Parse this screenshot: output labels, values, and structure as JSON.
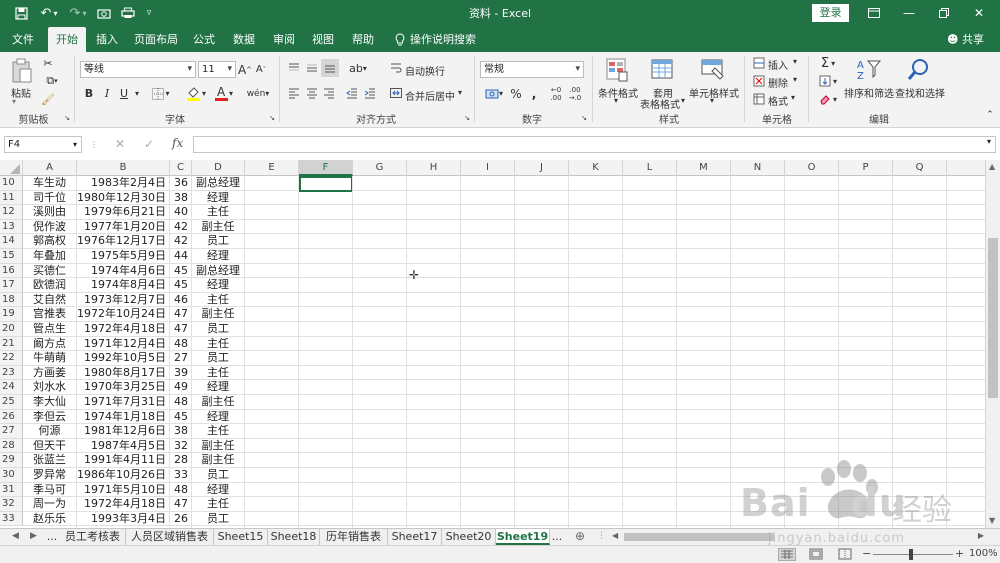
{
  "window": {
    "title": "资料 - Excel",
    "login": "登录",
    "share": "共享"
  },
  "tabs": [
    "文件",
    "开始",
    "插入",
    "页面布局",
    "公式",
    "数据",
    "审阅",
    "视图",
    "帮助"
  ],
  "active_tab": "开始",
  "tell_me": "操作说明搜索",
  "ribbon": {
    "clipboard": {
      "paste": "粘贴",
      "label": "剪贴板"
    },
    "font": {
      "name": "等线",
      "size": "11",
      "bold": "B",
      "italic": "I",
      "underline": "U",
      "grow": "A",
      "shrink": "A",
      "phonetic": "wén",
      "label": "字体"
    },
    "alignment": {
      "wrap": "自动换行",
      "merge": "合并后居中",
      "label": "对齐方式"
    },
    "number": {
      "format": "常规",
      "percent": "%",
      "comma": ",",
      "inc_dec": ".00",
      "label": "数字"
    },
    "styles": {
      "conditional": "条件格式",
      "table_line1": "套用",
      "table_line2": "表格格式",
      "cell_styles": "单元格样式",
      "label": "样式"
    },
    "cells": {
      "insert": "插入",
      "delete": "删除",
      "format": "格式",
      "label": "单元格"
    },
    "editing": {
      "sort": "排序和筛选",
      "find": "查找和选择",
      "label": "编辑"
    }
  },
  "formula_bar": {
    "name_box": "F4",
    "fx": "fx",
    "cancel": "✕",
    "enter": "✓"
  },
  "columns": [
    "A",
    "B",
    "C",
    "D",
    "E",
    "F",
    "G",
    "H",
    "I",
    "J",
    "K",
    "L",
    "M",
    "N",
    "O",
    "P",
    "Q"
  ],
  "selected_column": "F",
  "rows": [
    {
      "n": "10",
      "a": "车生动",
      "b": "1983年2月4日",
      "c": "36",
      "d": "副总经理"
    },
    {
      "n": "11",
      "a": "司千位",
      "b": "1980年12月30日",
      "c": "38",
      "d": "经理"
    },
    {
      "n": "12",
      "a": "溪则由",
      "b": "1979年6月21日",
      "c": "40",
      "d": "主任"
    },
    {
      "n": "13",
      "a": "倪作波",
      "b": "1977年1月20日",
      "c": "42",
      "d": "副主任"
    },
    {
      "n": "14",
      "a": "郭高权",
      "b": "1976年12月17日",
      "c": "42",
      "d": "员工"
    },
    {
      "n": "15",
      "a": "年叠加",
      "b": "1975年5月9日",
      "c": "44",
      "d": "经理"
    },
    {
      "n": "16",
      "a": "买德仁",
      "b": "1974年4月6日",
      "c": "45",
      "d": "副总经理"
    },
    {
      "n": "17",
      "a": "欧德润",
      "b": "1974年8月4日",
      "c": "45",
      "d": "经理"
    },
    {
      "n": "18",
      "a": "艾自然",
      "b": "1973年12月7日",
      "c": "46",
      "d": "主任"
    },
    {
      "n": "19",
      "a": "宫推表",
      "b": "1972年10月24日",
      "c": "47",
      "d": "副主任"
    },
    {
      "n": "20",
      "a": "管点生",
      "b": "1972年4月18日",
      "c": "47",
      "d": "员工"
    },
    {
      "n": "21",
      "a": "阚方点",
      "b": "1971年12月4日",
      "c": "48",
      "d": "主任"
    },
    {
      "n": "22",
      "a": "牛萌萌",
      "b": "1992年10月5日",
      "c": "27",
      "d": "员工"
    },
    {
      "n": "23",
      "a": "方画姜",
      "b": "1980年8月17日",
      "c": "39",
      "d": "主任"
    },
    {
      "n": "24",
      "a": "刘水水",
      "b": "1970年3月25日",
      "c": "49",
      "d": "经理"
    },
    {
      "n": "25",
      "a": "李大仙",
      "b": "1971年7月31日",
      "c": "48",
      "d": "副主任"
    },
    {
      "n": "26",
      "a": "李但云",
      "b": "1974年1月18日",
      "c": "45",
      "d": "经理"
    },
    {
      "n": "27",
      "a": "何源",
      "b": "1981年12月6日",
      "c": "38",
      "d": "主任"
    },
    {
      "n": "28",
      "a": "但天干",
      "b": "1987年4月5日",
      "c": "32",
      "d": "副主任"
    },
    {
      "n": "29",
      "a": "张蓝兰",
      "b": "1991年4月11日",
      "c": "28",
      "d": "副主任"
    },
    {
      "n": "30",
      "a": "罗异常",
      "b": "1986年10月26日",
      "c": "33",
      "d": "员工"
    },
    {
      "n": "31",
      "a": "季马可",
      "b": "1971年5月10日",
      "c": "48",
      "d": "经理"
    },
    {
      "n": "32",
      "a": "周一为",
      "b": "1972年4月18日",
      "c": "47",
      "d": "主任"
    },
    {
      "n": "33",
      "a": "赵乐乐",
      "b": "1993年3月4日",
      "c": "26",
      "d": "员工"
    }
  ],
  "sheets": [
    "...",
    "员工考核表",
    "人员区域销售表",
    "Sheet15",
    "Sheet18",
    "历年销售表",
    "Sheet17",
    "Sheet20",
    "Sheet19",
    "..."
  ],
  "active_sheet": "Sheet19",
  "status": {
    "zoom": "100%"
  },
  "watermark": {
    "brand": "Bai",
    "brand2": "du",
    "cn": "经验",
    "url": "jingyan.baidu.com"
  }
}
